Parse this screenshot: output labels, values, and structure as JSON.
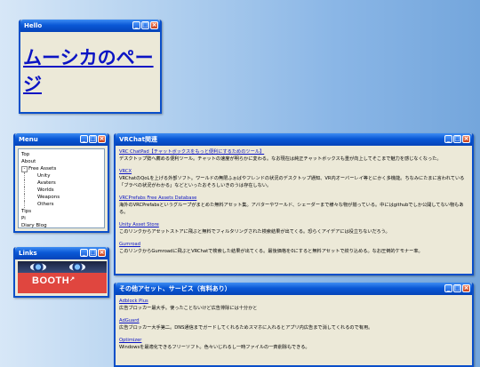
{
  "colors": {
    "titlebar": "#0a58d6",
    "link": "#0b14c4",
    "window_bg": "#ece9d8"
  },
  "hello": {
    "title": "Hello",
    "heading": "ムーシカのページ"
  },
  "menu": {
    "title": "Menu",
    "items": [
      {
        "label": "Top"
      },
      {
        "label": "About"
      },
      {
        "label": "Free Assets",
        "expander": "-"
      },
      {
        "label": "Unity"
      },
      {
        "label": "Avaters"
      },
      {
        "label": "Worlds"
      },
      {
        "label": "Weapons"
      },
      {
        "label": "Others"
      },
      {
        "label": "Tips"
      },
      {
        "label": "Pi"
      },
      {
        "label": "Diary Blog"
      }
    ]
  },
  "links": {
    "title": "Links",
    "banner_text": "BOOTH",
    "banner_mark": "↗"
  },
  "vrchat": {
    "title": "VRChat関連",
    "entries": [
      {
        "link": "VRC ChatPad【チャットボックスをもっと便利にするためのツール】",
        "desc": "デスクトップ勢へ薦める便利ツール。チャットの速度が明らかに変わる。なお現在は純正チャットボックスも重が向上してそこまで魅力を感じなくなった。"
      },
      {
        "link": "VRCX",
        "desc": "VRChatのQoLを上げる外部ソフト。ワールドの無限ふぉばやフレンドの状況のデスクトップ通知、VR内オーバーレイ等とにかく多機能。ちなみにたまに言われている「ブラベの状況がわかる」などといったおそろしいきのうは存在しない。"
      },
      {
        "link": "VRCPrefabs Free Assets Database",
        "desc": "海外のVRCPrefabsというグループがまとめた無料アセット集。アバターやワールド、シェーダーまで様々な物が揃っている。中にはgithubでしか公開してない物もある。"
      },
      {
        "link": "Unity Asset Store",
        "desc": "このリンクからアセットストアに飛ぶと無料でフィルタリングされた検索結果が出てくる。恐らくアイデアには役立ちないだろう。"
      },
      {
        "link": "Gumroad",
        "desc": "このリンクからGumroadに飛ぶとVRChatで検索した結果が出てくる。最後価格を0にすると無料アセットで絞り込める。なお圧倒的ケモナー率。"
      }
    ]
  },
  "others": {
    "title": "その他アセット、サービス（有料あり）",
    "entries": [
      {
        "link": "Adblock Plus",
        "desc": "広告ブロッカー最大手。使ったことないけど広告排除には十分かと"
      },
      {
        "link": "AdGuard",
        "desc": "広告ブロッカー大手第二。DNS通信までガードしてくれるためスマホに入れるとアプリ内広告まで消してくれるので有用。"
      },
      {
        "link": "Optimizer",
        "desc": "Windowsを最適化できるフリーソフト。色々いじれるし一時ファイルの一斉削除もできる。"
      }
    ]
  }
}
